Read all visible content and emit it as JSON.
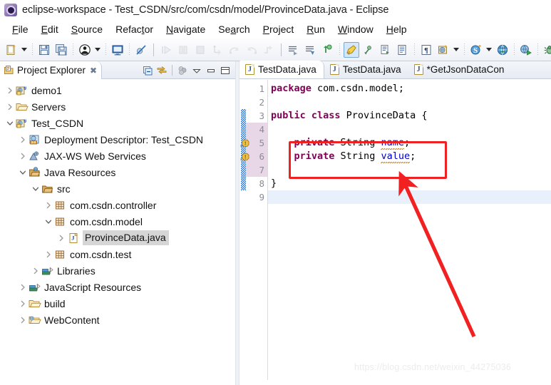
{
  "window": {
    "title": "eclipse-workspace - Test_CSDN/src/com/csdn/model/ProvinceData.java - Eclipse",
    "icon": "eclipse-icon"
  },
  "menubar": {
    "items": [
      {
        "label": "File",
        "mnemonic": "F"
      },
      {
        "label": "Edit",
        "mnemonic": "E"
      },
      {
        "label": "Source",
        "mnemonic": "S"
      },
      {
        "label": "Refactor",
        "mnemonic": "t"
      },
      {
        "label": "Navigate",
        "mnemonic": "N"
      },
      {
        "label": "Search",
        "mnemonic": "a"
      },
      {
        "label": "Project",
        "mnemonic": "P"
      },
      {
        "label": "Run",
        "mnemonic": "R"
      },
      {
        "label": "Window",
        "mnemonic": "W"
      },
      {
        "label": "Help",
        "mnemonic": "H"
      }
    ]
  },
  "toolbar": {
    "buttons": [
      {
        "name": "new-wizard-button",
        "icon": "new-file-icon",
        "enabled": true
      },
      {
        "name": "new-wizard-dropdown",
        "icon": "chevron-down-icon",
        "enabled": true
      },
      {
        "name": "save-button",
        "icon": "save-icon",
        "enabled": true
      },
      {
        "name": "save-all-button",
        "icon": "save-all-icon",
        "enabled": true
      },
      {
        "name": "external-tools-button",
        "icon": "person-icon",
        "enabled": true
      },
      {
        "name": "external-tools-dropdown",
        "icon": "chevron-down-icon",
        "enabled": true
      },
      {
        "name": "open-console-button",
        "icon": "console-icon",
        "enabled": true
      },
      {
        "name": "skip-breakpoints-button",
        "icon": "breakpoint-skip-icon",
        "enabled": true
      },
      {
        "name": "resume-button",
        "icon": "resume-icon",
        "enabled": false
      },
      {
        "name": "suspend-button",
        "icon": "suspend-icon",
        "enabled": false
      },
      {
        "name": "terminate-button",
        "icon": "terminate-icon",
        "enabled": false
      },
      {
        "name": "step-into-button",
        "icon": "step-into-icon",
        "enabled": false
      },
      {
        "name": "step-over-button",
        "icon": "step-over-icon",
        "enabled": false
      },
      {
        "name": "step-return-button",
        "icon": "step-return-icon",
        "enabled": false
      },
      {
        "name": "drop-to-frame-button",
        "icon": "drop-to-frame-icon",
        "enabled": false
      },
      {
        "name": "next-annotation-button",
        "icon": "next-annotation-icon",
        "enabled": true
      },
      {
        "name": "previous-annotation-button",
        "icon": "previous-annotation-icon",
        "enabled": true
      },
      {
        "name": "last-edit-location-button",
        "icon": "last-edit-location-icon",
        "enabled": true
      },
      {
        "name": "toggle-markoccurrences-button",
        "icon": "highlight-pen-icon",
        "enabled": true,
        "selected": true
      },
      {
        "name": "back-history-button",
        "icon": "back-arrow-icon",
        "enabled": true
      },
      {
        "name": "open-task-button",
        "icon": "task-icon",
        "enabled": true
      },
      {
        "name": "open-type-button",
        "icon": "open-type-icon",
        "enabled": true
      },
      {
        "name": "show-whitespace-button",
        "icon": "pilcrow-icon",
        "enabled": true
      },
      {
        "name": "new-web-project-button",
        "icon": "web-project-icon",
        "enabled": true
      },
      {
        "name": "new-web-project-dropdown",
        "icon": "chevron-down-icon",
        "enabled": true
      },
      {
        "name": "new-server-button",
        "icon": "server-s-icon",
        "enabled": true
      },
      {
        "name": "new-server-dropdown",
        "icon": "chevron-down-icon",
        "enabled": true
      },
      {
        "name": "open-browser-button",
        "icon": "globe-icon",
        "enabled": true
      },
      {
        "name": "run-on-server-button",
        "icon": "run-on-server-icon",
        "enabled": true
      },
      {
        "name": "debug-button",
        "icon": "bug-icon",
        "enabled": true
      },
      {
        "name": "debug-dropdown",
        "icon": "chevron-down-icon",
        "enabled": true
      },
      {
        "name": "run-button",
        "icon": "run-green-play-icon",
        "enabled": true
      }
    ]
  },
  "project_explorer": {
    "tab_label": "Project Explorer",
    "tab_icon": "project-explorer-icon",
    "close_glyph": "✖",
    "view_tools": [
      {
        "name": "collapse-all-button",
        "icon": "collapse-all-icon"
      },
      {
        "name": "link-with-editor-button",
        "icon": "link-editor-icon"
      },
      {
        "name": "view-menu-filters-button",
        "icon": "filters-icon"
      },
      {
        "name": "view-menu-button",
        "icon": "view-menu-chevron-icon"
      },
      {
        "name": "minimize-view-button",
        "icon": "minimize-icon"
      },
      {
        "name": "maximize-view-button",
        "icon": "maximize-icon"
      }
    ],
    "tree": [
      {
        "label": "demo1",
        "depth": 0,
        "twisty": "collapsed",
        "icon": "java-web-project-icon",
        "selected": false
      },
      {
        "label": "Servers",
        "depth": 0,
        "twisty": "collapsed",
        "icon": "folder-open-icon",
        "selected": false
      },
      {
        "label": "Test_CSDN",
        "depth": 0,
        "twisty": "expanded",
        "icon": "java-web-project-icon",
        "selected": false
      },
      {
        "label": "Deployment Descriptor: Test_CSDN",
        "depth": 1,
        "twisty": "collapsed",
        "icon": "deployment-descriptor-icon",
        "selected": false
      },
      {
        "label": "JAX-WS Web Services",
        "depth": 1,
        "twisty": "collapsed",
        "icon": "jaxws-icon",
        "selected": false
      },
      {
        "label": "Java Resources",
        "depth": 1,
        "twisty": "expanded",
        "icon": "java-resources-icon",
        "selected": false
      },
      {
        "label": "src",
        "depth": 2,
        "twisty": "expanded",
        "icon": "source-folder-icon",
        "selected": false
      },
      {
        "label": "com.csdn.controller",
        "depth": 3,
        "twisty": "collapsed",
        "icon": "package-icon",
        "selected": false
      },
      {
        "label": "com.csdn.model",
        "depth": 3,
        "twisty": "expanded",
        "icon": "package-icon",
        "selected": false
      },
      {
        "label": "ProvinceData.java",
        "depth": 4,
        "twisty": "collapsed",
        "icon": "java-file-icon",
        "selected": true
      },
      {
        "label": "com.csdn.test",
        "depth": 3,
        "twisty": "collapsed",
        "icon": "package-icon",
        "selected": false
      },
      {
        "label": "Libraries",
        "depth": 2,
        "twisty": "collapsed",
        "icon": "libraries-icon",
        "selected": false
      },
      {
        "label": "JavaScript Resources",
        "depth": 1,
        "twisty": "collapsed",
        "icon": "libraries-icon",
        "selected": false
      },
      {
        "label": "build",
        "depth": 1,
        "twisty": "collapsed",
        "icon": "folder-open-icon",
        "selected": false
      },
      {
        "label": "WebContent",
        "depth": 1,
        "twisty": "collapsed",
        "icon": "web-folder-icon",
        "selected": false
      }
    ]
  },
  "editor": {
    "tabs": [
      {
        "label": "TestData.java",
        "icon": "java-file-icon",
        "active": true,
        "dirty": false
      },
      {
        "label": "TestData.java",
        "icon": "java-file-icon",
        "active": false,
        "dirty": false
      },
      {
        "label": "*GetJsonDataCon",
        "icon": "java-file-icon",
        "active": false,
        "dirty": true
      }
    ],
    "lines": [
      {
        "number": "1",
        "tokens": [
          {
            "t": "package",
            "c": "kw"
          },
          {
            "t": " com.csdn.model;",
            "c": "pl"
          }
        ]
      },
      {
        "number": "2",
        "tokens": []
      },
      {
        "number": "3",
        "tokens": [
          {
            "t": "public class",
            "c": "kw"
          },
          {
            "t": " ProvinceData {",
            "c": "pl"
          }
        ]
      },
      {
        "number": "4",
        "tokens": []
      },
      {
        "number": "5",
        "tokens": [
          {
            "t": "    ",
            "c": "pl"
          },
          {
            "t": "private",
            "c": "kw"
          },
          {
            "t": " String ",
            "c": "pl"
          },
          {
            "t": "name",
            "c": "fld sqg"
          },
          {
            "t": ";",
            "c": "pl"
          }
        ]
      },
      {
        "number": "6",
        "tokens": [
          {
            "t": "    ",
            "c": "pl"
          },
          {
            "t": "private",
            "c": "kw"
          },
          {
            "t": " String ",
            "c": "pl"
          },
          {
            "t": "value",
            "c": "fld sqg"
          },
          {
            "t": ";",
            "c": "pl"
          }
        ]
      },
      {
        "number": "7",
        "tokens": []
      },
      {
        "number": "8",
        "tokens": [
          {
            "t": "}",
            "c": "pl"
          }
        ]
      },
      {
        "number": "9",
        "tokens": []
      }
    ],
    "warning_lines": [
      5,
      6
    ],
    "changed_line_range": [
      3,
      8
    ],
    "highlighted_number_range": [
      4,
      7
    ],
    "current_line": 9,
    "colors": {
      "keyword": "#7f0055",
      "field": "#0000c0",
      "plain": "#000000",
      "current_line_bg": "#e8f1fb",
      "changed_bar": "#1a6fd4",
      "gutter_highlight": "#e7d7e7"
    }
  },
  "annotation": {
    "box_color": "#ee2222",
    "arrow_color": "#f22121",
    "box_covers": "private String name; private String value;"
  },
  "watermark": {
    "text": "https://blog.csdn.net/weixin_44275036"
  }
}
